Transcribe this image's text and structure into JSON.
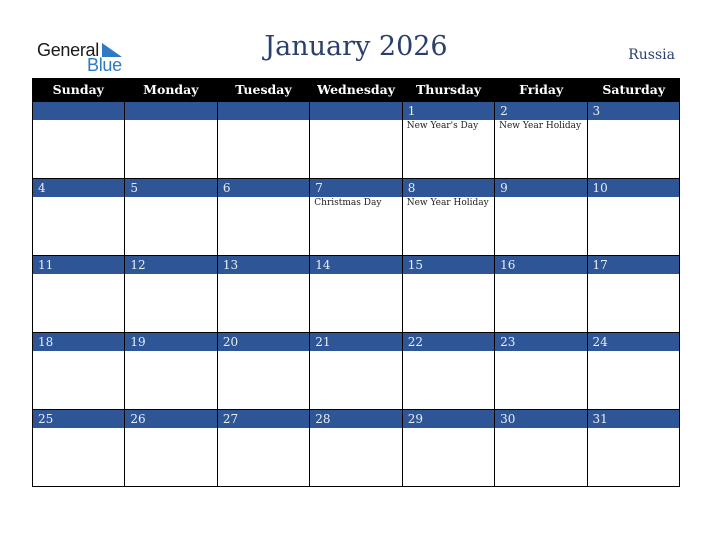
{
  "logo": {
    "line1": "General",
    "line2": "Blue"
  },
  "title": "January 2026",
  "country": "Russia",
  "weekdays": [
    "Sunday",
    "Monday",
    "Tuesday",
    "Wednesday",
    "Thursday",
    "Friday",
    "Saturday"
  ],
  "weeks": [
    [
      {
        "date": "",
        "event": ""
      },
      {
        "date": "",
        "event": ""
      },
      {
        "date": "",
        "event": ""
      },
      {
        "date": "",
        "event": ""
      },
      {
        "date": "1",
        "event": "New Year's Day"
      },
      {
        "date": "2",
        "event": "New Year Holiday"
      },
      {
        "date": "3",
        "event": ""
      }
    ],
    [
      {
        "date": "4",
        "event": ""
      },
      {
        "date": "5",
        "event": ""
      },
      {
        "date": "6",
        "event": ""
      },
      {
        "date": "7",
        "event": "Christmas Day"
      },
      {
        "date": "8",
        "event": "New Year Holiday"
      },
      {
        "date": "9",
        "event": ""
      },
      {
        "date": "10",
        "event": ""
      }
    ],
    [
      {
        "date": "11",
        "event": ""
      },
      {
        "date": "12",
        "event": ""
      },
      {
        "date": "13",
        "event": ""
      },
      {
        "date": "14",
        "event": ""
      },
      {
        "date": "15",
        "event": ""
      },
      {
        "date": "16",
        "event": ""
      },
      {
        "date": "17",
        "event": ""
      }
    ],
    [
      {
        "date": "18",
        "event": ""
      },
      {
        "date": "19",
        "event": ""
      },
      {
        "date": "20",
        "event": ""
      },
      {
        "date": "21",
        "event": ""
      },
      {
        "date": "22",
        "event": ""
      },
      {
        "date": "23",
        "event": ""
      },
      {
        "date": "24",
        "event": ""
      }
    ],
    [
      {
        "date": "25",
        "event": ""
      },
      {
        "date": "26",
        "event": ""
      },
      {
        "date": "27",
        "event": ""
      },
      {
        "date": "28",
        "event": ""
      },
      {
        "date": "29",
        "event": ""
      },
      {
        "date": "30",
        "event": ""
      },
      {
        "date": "31",
        "event": ""
      }
    ]
  ],
  "colors": {
    "header_bg": "#000000",
    "date_strip": "#2e5595",
    "title": "#2b3f6b",
    "logo_blue": "#2e7bc4"
  }
}
